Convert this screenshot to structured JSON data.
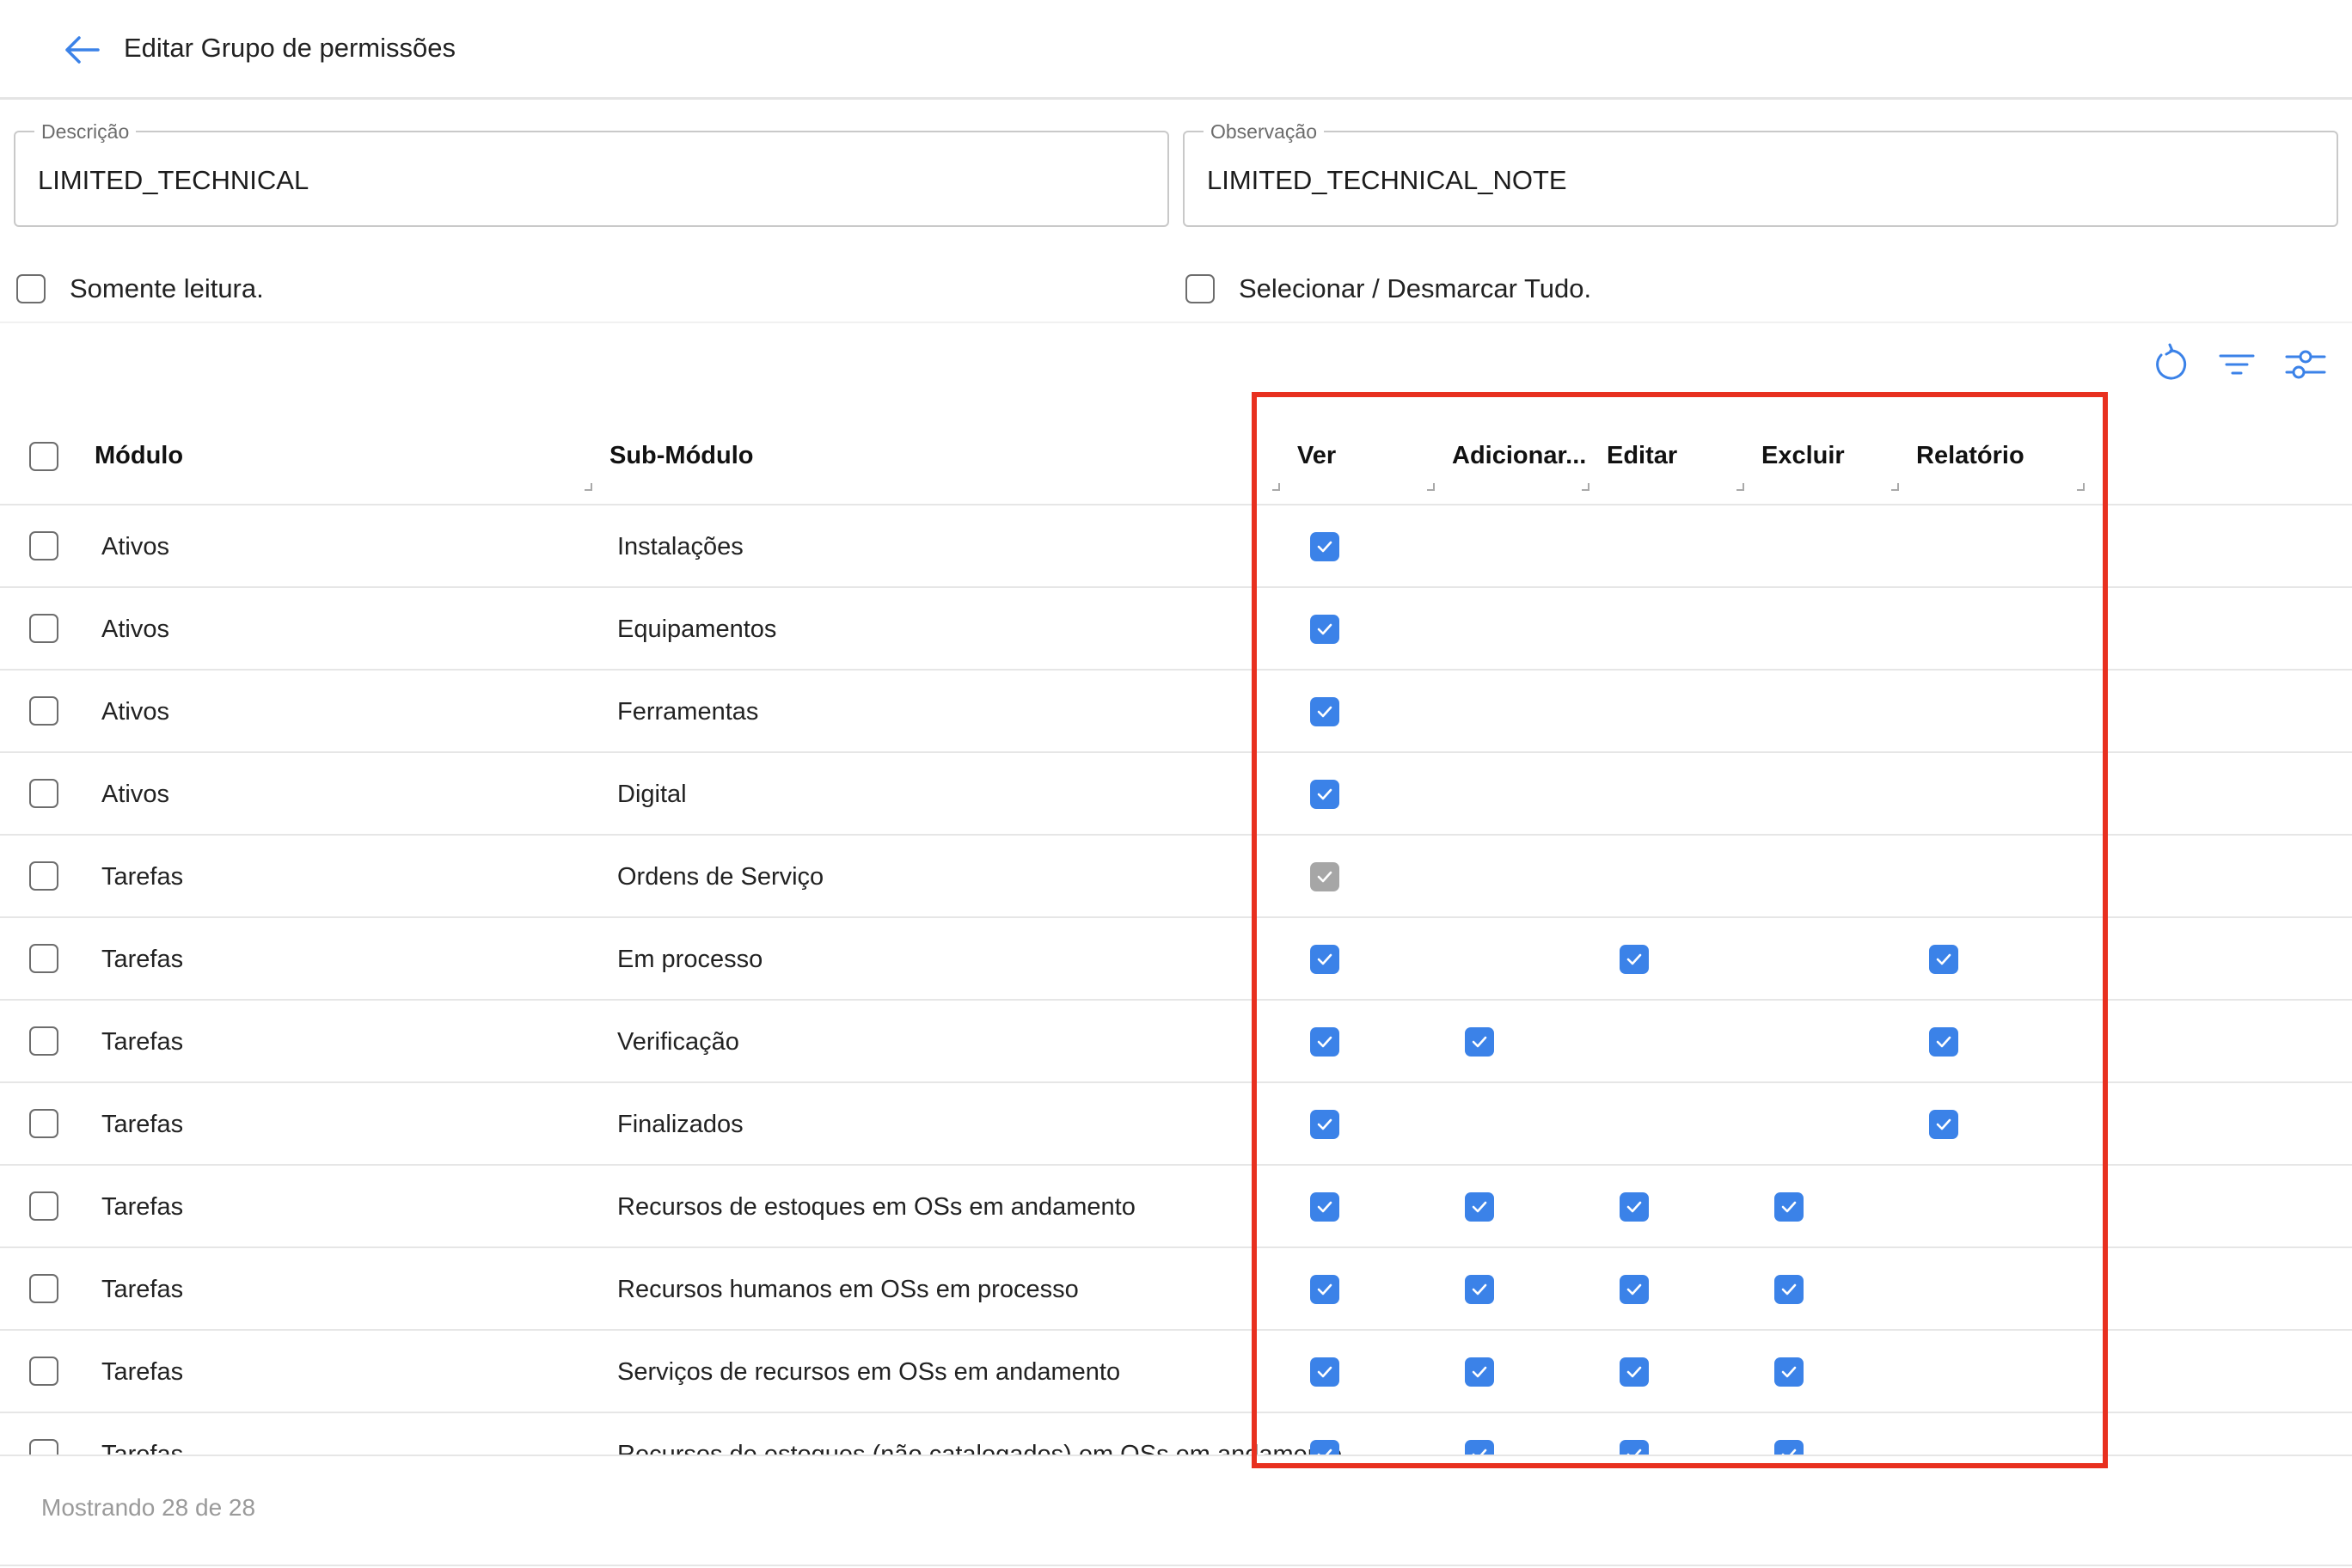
{
  "header": {
    "title": "Editar Grupo de permissões"
  },
  "form": {
    "description": {
      "label": "Descrição",
      "value": "LIMITED_TECHNICAL"
    },
    "observation": {
      "label": "Observação",
      "value": "LIMITED_TECHNICAL_NOTE"
    },
    "readonly_label": "Somente leitura.",
    "select_all_label": "Selecionar / Desmarcar Tudo."
  },
  "toolbar": {
    "icons": [
      "refresh-icon",
      "filter-icon",
      "column-settings-icon"
    ]
  },
  "table": {
    "columns": {
      "module": "Módulo",
      "submodule": "Sub-Módulo",
      "view": "Ver",
      "add": "Adicionar...",
      "edit": "Editar",
      "delete": "Excluir",
      "report": "Relatório"
    },
    "rows": [
      {
        "module": "Ativos",
        "submodule": "Instalações",
        "perms": [
          "checked",
          "",
          "",
          "",
          ""
        ]
      },
      {
        "module": "Ativos",
        "submodule": "Equipamentos",
        "perms": [
          "checked",
          "",
          "",
          "",
          ""
        ]
      },
      {
        "module": "Ativos",
        "submodule": "Ferramentas",
        "perms": [
          "checked",
          "",
          "",
          "",
          ""
        ]
      },
      {
        "module": "Ativos",
        "submodule": "Digital",
        "perms": [
          "checked",
          "",
          "",
          "",
          ""
        ]
      },
      {
        "module": "Tarefas",
        "submodule": "Ordens de Serviço",
        "perms": [
          "disabled",
          "",
          "",
          "",
          ""
        ]
      },
      {
        "module": "Tarefas",
        "submodule": "Em processo",
        "perms": [
          "checked",
          "",
          "checked",
          "",
          "checked"
        ]
      },
      {
        "module": "Tarefas",
        "submodule": "Verificação",
        "perms": [
          "checked",
          "checked",
          "",
          "",
          "checked"
        ]
      },
      {
        "module": "Tarefas",
        "submodule": "Finalizados",
        "perms": [
          "checked",
          "",
          "",
          "",
          "checked"
        ]
      },
      {
        "module": "Tarefas",
        "submodule": "Recursos de estoques em OSs em andamento",
        "perms": [
          "checked",
          "checked",
          "checked",
          "checked",
          ""
        ]
      },
      {
        "module": "Tarefas",
        "submodule": "Recursos humanos em OSs em processo",
        "perms": [
          "checked",
          "checked",
          "checked",
          "checked",
          ""
        ]
      },
      {
        "module": "Tarefas",
        "submodule": "Serviços de recursos em OSs em andamento",
        "perms": [
          "checked",
          "checked",
          "checked",
          "checked",
          ""
        ]
      },
      {
        "module": "Tarefas",
        "submodule": "Recursos de estoques (não catalogados) em OSs em andamento",
        "perms": [
          "checked",
          "checked",
          "checked",
          "checked",
          ""
        ]
      }
    ]
  },
  "footer": {
    "status": "Mostrando 28 de 28"
  },
  "colors": {
    "accent": "#3b82e8",
    "highlight": "#e8301f",
    "disabled": "#a6a6a6"
  }
}
